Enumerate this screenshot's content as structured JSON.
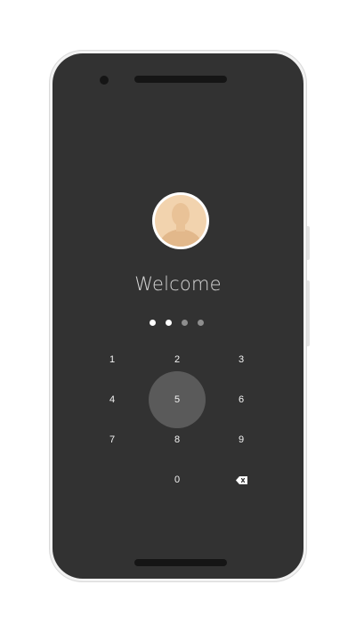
{
  "greeting": "Welcome",
  "avatar_icon": "user-avatar-icon",
  "pin": {
    "entered": 2,
    "total": 4
  },
  "keypad": {
    "keys": [
      "1",
      "2",
      "3",
      "4",
      "5",
      "6",
      "7",
      "8",
      "9",
      "0"
    ],
    "pressed_key": "5",
    "backspace_icon": "backspace-icon"
  },
  "colors": {
    "screen": "#323232",
    "pressed_key": "#5a5a5a",
    "avatar_skin": "#f2d3ae",
    "filled_dot": "#ffffff",
    "empty_dot": "#8e8e8e"
  }
}
